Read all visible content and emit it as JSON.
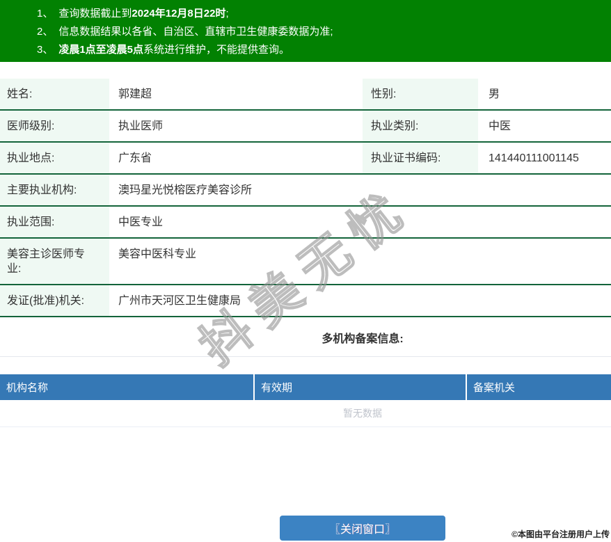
{
  "notice": {
    "bg_color": "#028102",
    "lines": [
      {
        "num": "1、",
        "pre": "查询数据截止到",
        "bold": "2024年12月8日22时",
        "post": ";"
      },
      {
        "num": "2、",
        "pre": "信息数据结果以各省、自治区、直辖市卫生健康委数据为准;",
        "bold": "",
        "post": ""
      },
      {
        "num": "3、",
        "pre": "",
        "bold": "凌晨1点至凌晨5点",
        "post": "系统进行维护，不能提供查询。"
      }
    ]
  },
  "details": {
    "label_bg": "#eff9f3",
    "divider_color": "#13643a",
    "rows": [
      {
        "cells": [
          {
            "label": "姓名:",
            "value": "郭建超"
          },
          {
            "label": "性别:",
            "value": "男"
          }
        ]
      },
      {
        "cells": [
          {
            "label": "医师级别:",
            "value": "执业医师"
          },
          {
            "label": "执业类别:",
            "value": "中医"
          }
        ]
      },
      {
        "cells": [
          {
            "label": "执业地点:",
            "value": "广东省"
          },
          {
            "label": "执业证书编码:",
            "value": "141440111001145"
          }
        ]
      },
      {
        "cells": [
          {
            "label": "主要执业机构:",
            "value": "澳玛星光悦榕医疗美容诊所"
          }
        ]
      },
      {
        "cells": [
          {
            "label": "执业范围:",
            "value": "中医专业"
          }
        ]
      },
      {
        "cells": [
          {
            "label": "美容主诊医师专业:",
            "value": "美容中医科专业"
          }
        ]
      },
      {
        "cells": [
          {
            "label": "发证(批准)机关:",
            "value": "广州市天河区卫生健康局"
          }
        ]
      }
    ]
  },
  "filing": {
    "title": "多机构备案信息:",
    "header_bg": "#3578b5",
    "columns": [
      "机构名称",
      "有效期",
      "备案机关"
    ],
    "empty_text": "暂无数据"
  },
  "watermark": {
    "text": "抖美无忧"
  },
  "footer": {
    "close_button_label": "〖关闭窗口〗",
    "button_color": "#3c83c3",
    "credit": "©本图由平台注册用户上传"
  }
}
